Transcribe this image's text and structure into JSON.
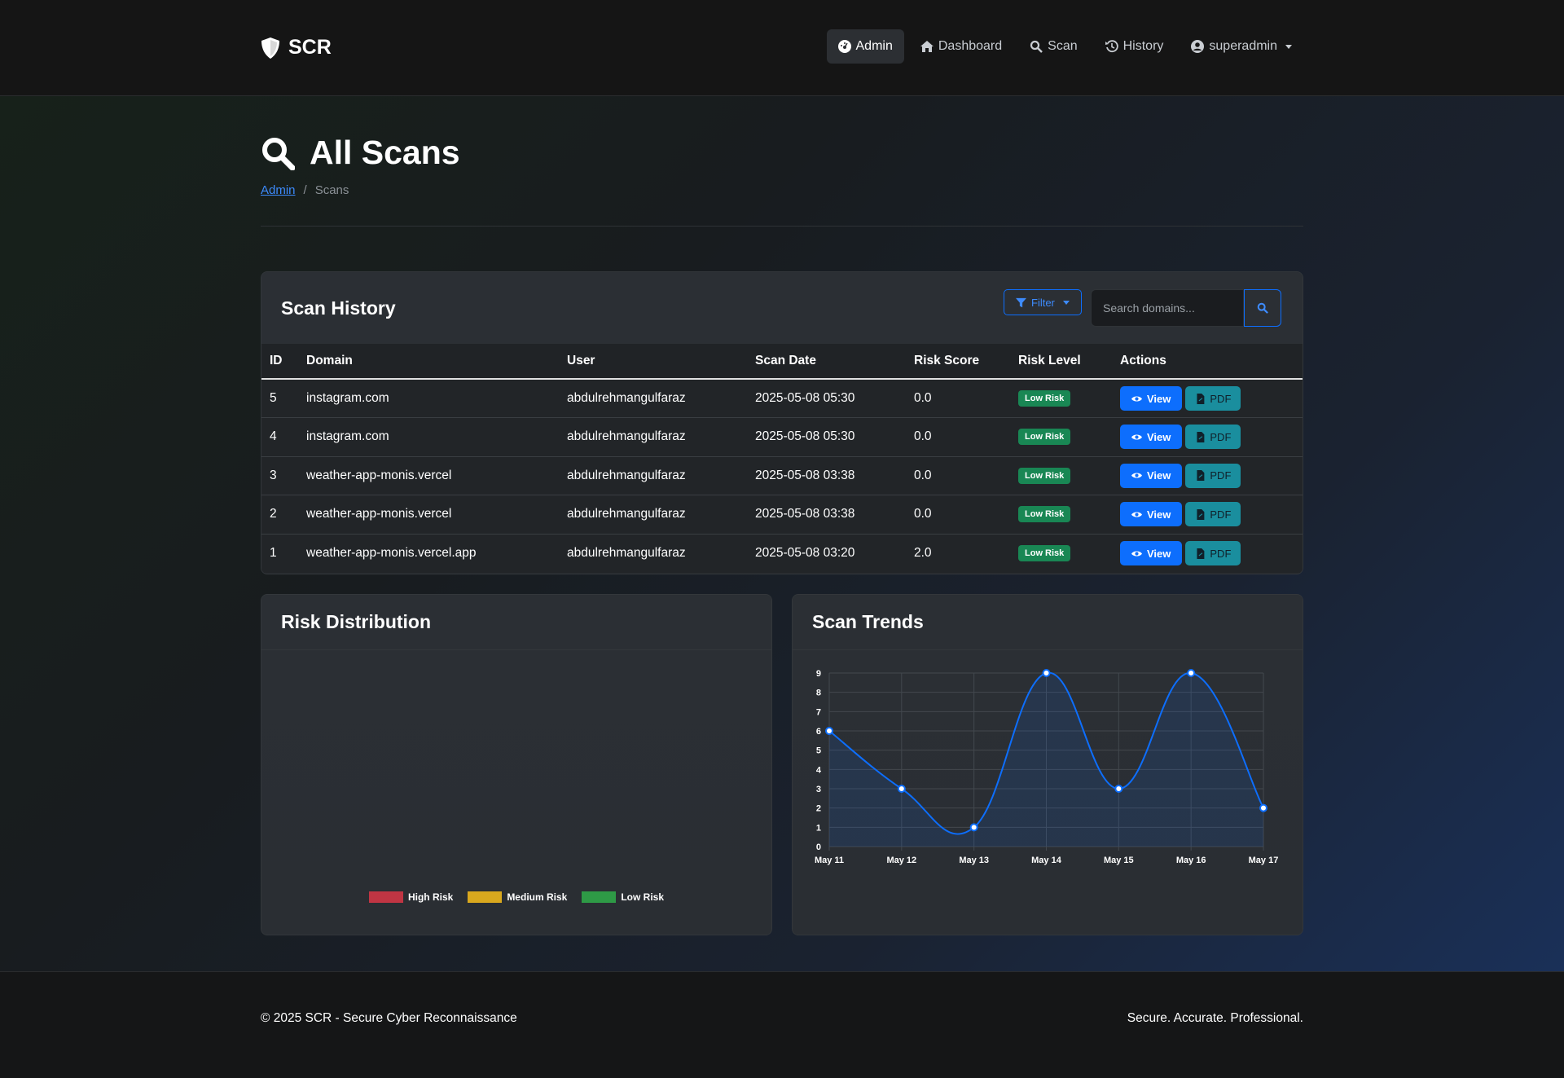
{
  "nav": {
    "brand": "SCR",
    "links": [
      {
        "label": "Admin",
        "icon": "gauge-icon"
      },
      {
        "label": "Dashboard",
        "icon": "home-icon"
      },
      {
        "label": "Scan",
        "icon": "search-icon"
      },
      {
        "label": "History",
        "icon": "history-icon"
      },
      {
        "label": "superadmin",
        "icon": "user-circle-icon"
      }
    ]
  },
  "header": {
    "title": "All Scans",
    "breadcrumb": {
      "parent": "Admin",
      "separator": "/",
      "current": "Scans"
    }
  },
  "scan_history": {
    "title": "Scan History",
    "filter_label": "Filter",
    "search_placeholder": "Search domains...",
    "columns": [
      "ID",
      "Domain",
      "User",
      "Scan Date",
      "Risk Score",
      "Risk Level",
      "Actions"
    ],
    "rows": [
      {
        "id": "5",
        "domain": "instagram.com",
        "user": "abdulrehmangulfaraz",
        "date": "2025-05-08 05:30",
        "score": "0.0",
        "level": "Low Risk"
      },
      {
        "id": "4",
        "domain": "instagram.com",
        "user": "abdulrehmangulfaraz",
        "date": "2025-05-08 05:30",
        "score": "0.0",
        "level": "Low Risk"
      },
      {
        "id": "3",
        "domain": "weather-app-monis.vercel",
        "user": "abdulrehmangulfaraz",
        "date": "2025-05-08 03:38",
        "score": "0.0",
        "level": "Low Risk"
      },
      {
        "id": "2",
        "domain": "weather-app-monis.vercel",
        "user": "abdulrehmangulfaraz",
        "date": "2025-05-08 03:38",
        "score": "0.0",
        "level": "Low Risk"
      },
      {
        "id": "1",
        "domain": "weather-app-monis.vercel.app",
        "user": "abdulrehmangulfaraz",
        "date": "2025-05-08 03:20",
        "score": "2.0",
        "level": "Low Risk"
      }
    ],
    "view_label": "View",
    "pdf_label": "PDF"
  },
  "risk_distribution": {
    "title": "Risk Distribution",
    "legend": [
      {
        "label": "High Risk",
        "color": "#dc3545"
      },
      {
        "label": "Medium Risk",
        "color": "#ffc107"
      },
      {
        "label": "Low Risk",
        "color": "#28a745"
      }
    ]
  },
  "scan_trends": {
    "title": "Scan Trends"
  },
  "chart_data": {
    "type": "line",
    "title": "",
    "x": [
      "May 11",
      "May 12",
      "May 13",
      "May 14",
      "May 15",
      "May 16",
      "May 17"
    ],
    "series": [
      {
        "values": [
          6,
          3,
          1,
          9,
          3,
          9,
          2
        ]
      }
    ],
    "ylim": [
      0,
      9
    ],
    "yticks": [
      0,
      1,
      2,
      3,
      4,
      5,
      6,
      7,
      8,
      9
    ],
    "grid": true,
    "color": "#0d6efd"
  },
  "footer": {
    "left": "© 2025 SCR - Secure Cyber Reconnaissance",
    "right": "Secure. Accurate. Professional."
  }
}
